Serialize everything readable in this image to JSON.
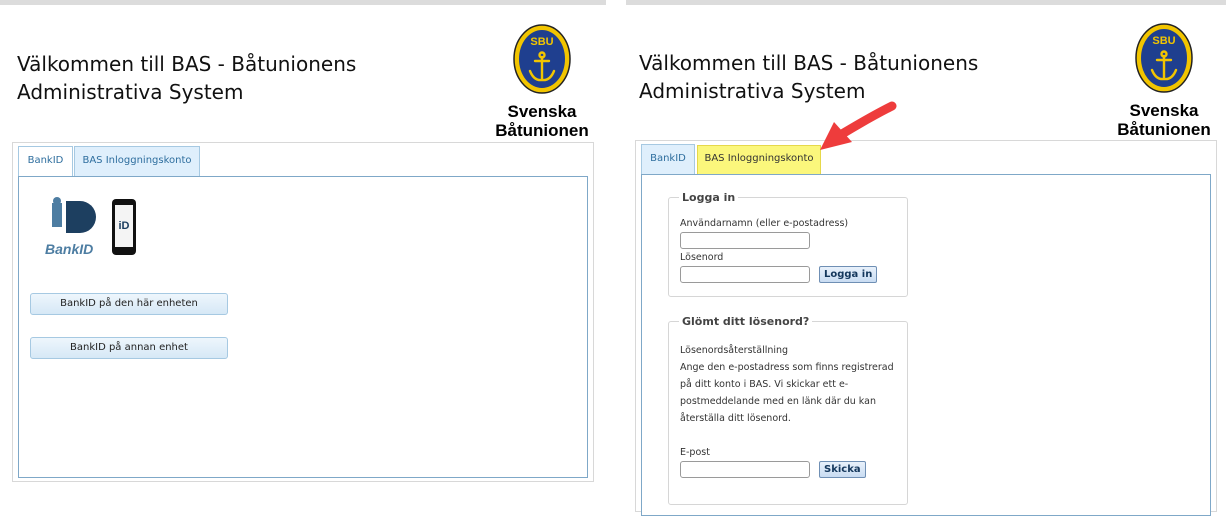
{
  "header": {
    "title_line1": "Välkommen till BAS - Båtunionens",
    "title_line2": "Administrativa System"
  },
  "logo": {
    "badge_text": "SBU",
    "name_line1": "Svenska",
    "name_line2": "Båtunionen",
    "icon": "anchor-icon",
    "badge_color": "#1f3f8f",
    "badge_ring_color": "#f2c500"
  },
  "tabs": {
    "bankid": "BankID",
    "account": "BAS Inloggningskonto"
  },
  "bankid_panel": {
    "logo_text": "BankID",
    "btn_this_device": "BankID på den här enheten",
    "btn_other_device": "BankID på annan enhet"
  },
  "login_panel": {
    "legend": "Logga in",
    "username_label": "Användarnamn (eller e-postadress)",
    "password_label": "Lösenord",
    "submit": "Logga in"
  },
  "forgot_panel": {
    "legend": "Glömt ditt lösenord?",
    "heading": "Lösenordsåterställning",
    "text": "Ange den e-postadress som finns registrerad på ditt konto i BAS. Vi skickar ett e-postmeddelande med en länk där du kan återställa ditt lösenord.",
    "email_label": "E-post",
    "submit": "Skicka"
  },
  "colors": {
    "highlight": "#fbf77c",
    "arrow": "#ee3c3c",
    "tab_border": "#a6c9e2"
  }
}
